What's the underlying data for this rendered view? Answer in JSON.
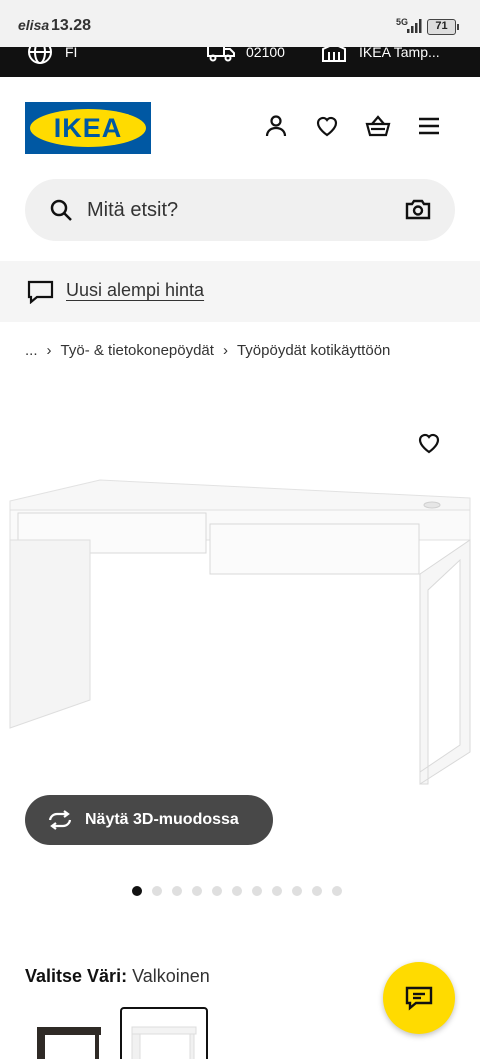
{
  "status_bar": {
    "carrier": "elisa",
    "time": "13.28",
    "network": "5G",
    "battery": "71"
  },
  "utility": {
    "language": "FI",
    "postal_code": "02100",
    "store": "IKEA Tamp..."
  },
  "header": {
    "logo_text": "IKEA",
    "icons": [
      "user-icon",
      "heart-icon",
      "basket-icon",
      "menu-icon"
    ]
  },
  "search": {
    "placeholder": "Mitä etsit?"
  },
  "promo": {
    "text": "Uusi alempi hinta"
  },
  "breadcrumb": {
    "items": [
      "...",
      "Työ- & tietokonepöydät",
      "Työpöydät kotikäyttöön"
    ]
  },
  "product": {
    "view_3d_label": "Näytä 3D-muodossa",
    "image_count": 11,
    "active_image": 1
  },
  "color": {
    "label": "Valitse Väri:",
    "value": "Valkoinen"
  },
  "colors": {
    "brand_blue": "#0058a3",
    "brand_yellow": "#ffdb00"
  }
}
